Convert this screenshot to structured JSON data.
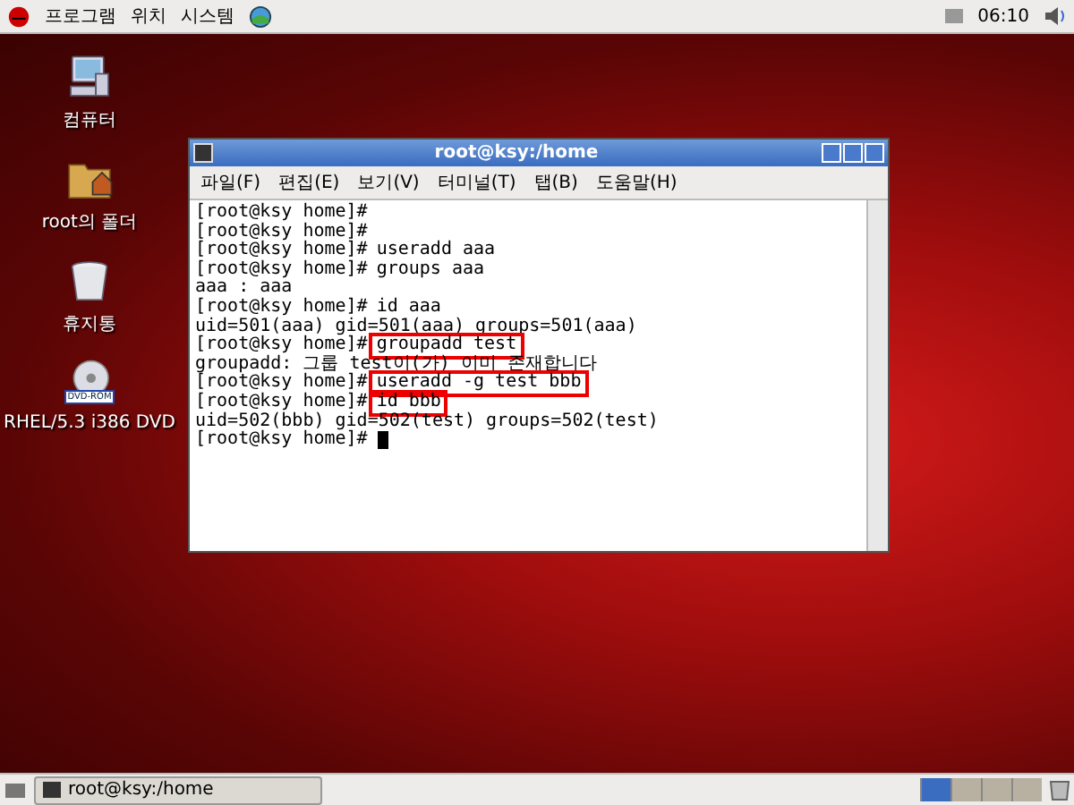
{
  "top_panel": {
    "menus": [
      "프로그램",
      "위치",
      "시스템"
    ],
    "clock": "06:10"
  },
  "desktop_icons": [
    {
      "kind": "computer",
      "label": "컴퓨터"
    },
    {
      "kind": "folder",
      "label": "root의 폴더"
    },
    {
      "kind": "trash",
      "label": "휴지통"
    },
    {
      "kind": "dvd",
      "label": "RHEL/5.3 i386 DVD",
      "badge": "DVD-ROM"
    }
  ],
  "window": {
    "title": "root@ksy:/home",
    "menus": [
      "파일(F)",
      "편집(E)",
      "보기(V)",
      "터미널(T)",
      "탭(B)",
      "도움말(H)"
    ],
    "lines": [
      {
        "kind": "prompt",
        "prompt": "[root@ksy home]#"
      },
      {
        "kind": "prompt",
        "prompt": "[root@ksy home]#"
      },
      {
        "kind": "prompt",
        "prompt": "[root@ksy home]#",
        "command": "useradd aaa"
      },
      {
        "kind": "prompt",
        "prompt": "[root@ksy home]#",
        "command": "groups aaa"
      },
      {
        "kind": "output",
        "text": "aaa : aaa"
      },
      {
        "kind": "prompt",
        "prompt": "[root@ksy home]#",
        "command": "id aaa"
      },
      {
        "kind": "output",
        "text": "uid=501(aaa) gid=501(aaa) groups=501(aaa)"
      },
      {
        "kind": "prompt",
        "prompt": "[root@ksy home]#",
        "command": "groupadd test",
        "highlighted": true
      },
      {
        "kind": "output",
        "text": "groupadd: 그룹 test이(가) 이미 존재합니다"
      },
      {
        "kind": "prompt",
        "prompt": "[root@ksy home]#",
        "command": "useradd -g test bbb",
        "highlighted": true
      },
      {
        "kind": "prompt",
        "prompt": "[root@ksy home]#",
        "command": "id bbb",
        "highlighted": true
      },
      {
        "kind": "output",
        "text": "uid=502(bbb) gid=502(test) groups=502(test)"
      },
      {
        "kind": "prompt",
        "prompt": "[root@ksy home]#",
        "cursor": true
      }
    ]
  },
  "taskbar": {
    "tasks": [
      {
        "label": "root@ksy:/home",
        "selected": false
      }
    ],
    "workspaces": [
      {
        "selected": true
      },
      {
        "selected": false
      },
      {
        "selected": false
      },
      {
        "selected": false
      }
    ]
  }
}
